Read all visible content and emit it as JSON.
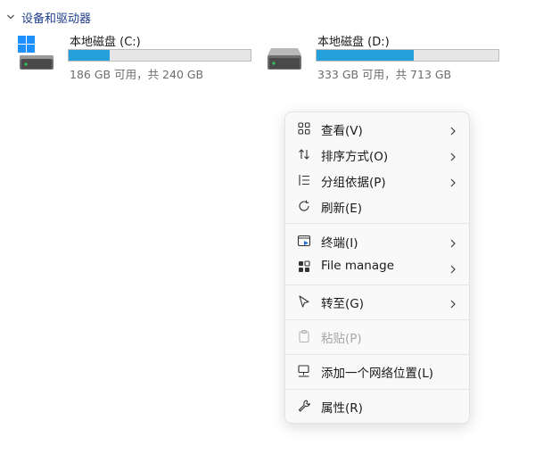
{
  "section": {
    "title": "设备和驱动器",
    "chevron_icon": "chevron-down-icon"
  },
  "drives": [
    {
      "name": "本地磁盘 (C:)",
      "free_text": "186 GB 可用，共 240 GB",
      "used_fraction": 0.225,
      "icon": "windows-drive-icon",
      "bar_color": "#26a0da"
    },
    {
      "name": "本地磁盘 (D:)",
      "free_text": "333 GB 可用，共 713 GB",
      "used_fraction": 0.533,
      "icon": "drive-icon",
      "bar_color": "#26a0da"
    }
  ],
  "context_menu": {
    "items": [
      {
        "label": "查看(V)",
        "icon": "grid-icon",
        "submenu": true
      },
      {
        "label": "排序方式(O)",
        "icon": "sort-icon",
        "submenu": true
      },
      {
        "label": "分组依据(P)",
        "icon": "list-group-icon",
        "submenu": true
      },
      {
        "label": "刷新(E)",
        "icon": "refresh-icon",
        "submenu": false
      },
      {
        "label": "终端(I)",
        "icon": "terminal-icon",
        "submenu": true
      },
      {
        "label": "File manage",
        "icon": "apps-grid-icon",
        "submenu": true
      },
      {
        "label": "转至(G)",
        "icon": "cursor-icon",
        "submenu": true
      },
      {
        "label": "粘贴(P)",
        "icon": "clipboard-icon",
        "submenu": false,
        "disabled": true
      },
      {
        "label": "添加一个网络位置(L)",
        "icon": "network-location-icon",
        "submenu": false
      },
      {
        "label": "属性(R)",
        "icon": "wrench-icon",
        "submenu": false
      }
    ]
  }
}
